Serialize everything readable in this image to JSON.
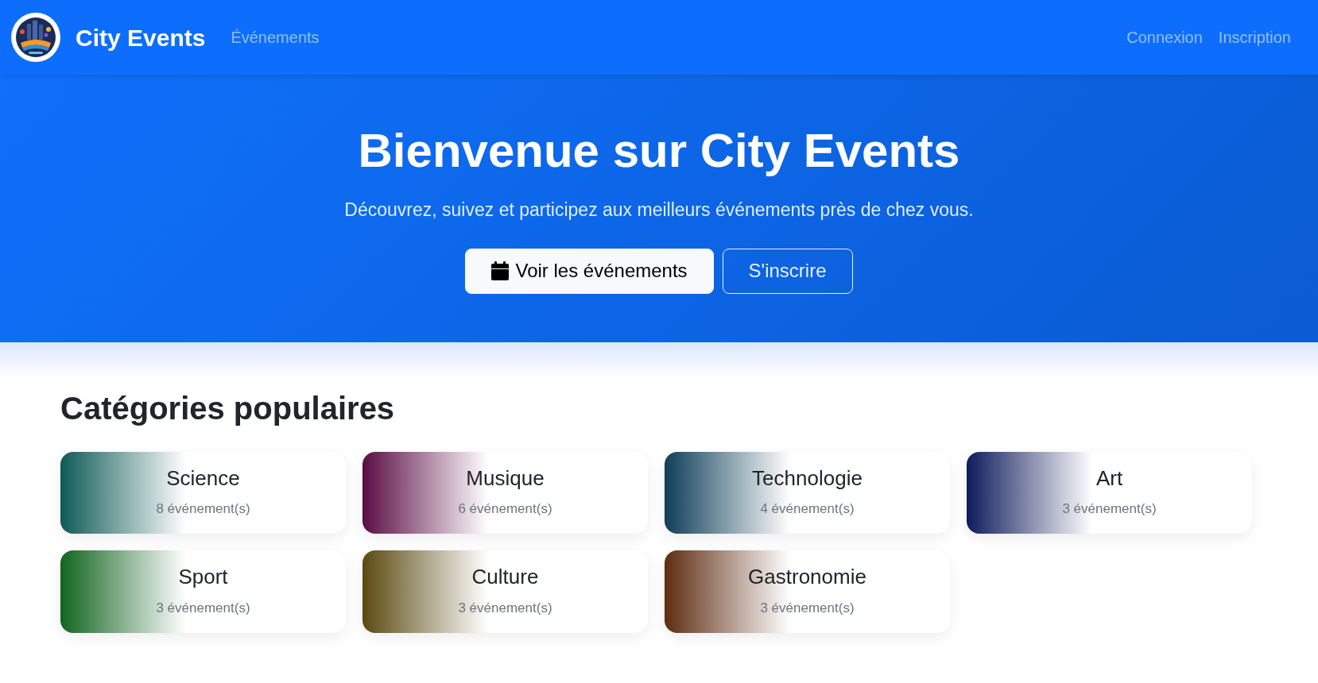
{
  "navbar": {
    "brand": "City Events",
    "links": [
      "Événements"
    ],
    "account_links": [
      "Connexion",
      "Inscription"
    ]
  },
  "hero": {
    "title": "Bienvenue sur City Events",
    "subtitle": "Découvrez, suivez et participez aux meilleurs événements près de chez vous.",
    "buttons": [
      {
        "label": "Voir les événements",
        "kind": "light"
      },
      {
        "label": "S'inscrire",
        "kind": "outline"
      }
    ]
  },
  "categories": {
    "title": "Catégories populaires",
    "items": [
      {
        "name": "Science",
        "count": "8 événement(s)",
        "color": "#0e5a55"
      },
      {
        "name": "Musique",
        "count": "6 événement(s)",
        "color": "#5a0c44"
      },
      {
        "name": "Technologie",
        "count": "4 événement(s)",
        "color": "#0e3e57"
      },
      {
        "name": "Art",
        "count": "3 événement(s)",
        "color": "#0e1b5c"
      },
      {
        "name": "Sport",
        "count": "3 événement(s)",
        "color": "#126420"
      },
      {
        "name": "Culture",
        "count": "3 événement(s)",
        "color": "#5a4a10"
      },
      {
        "name": "Gastronomie",
        "count": "3 événement(s)",
        "color": "#5e2c10"
      }
    ]
  }
}
